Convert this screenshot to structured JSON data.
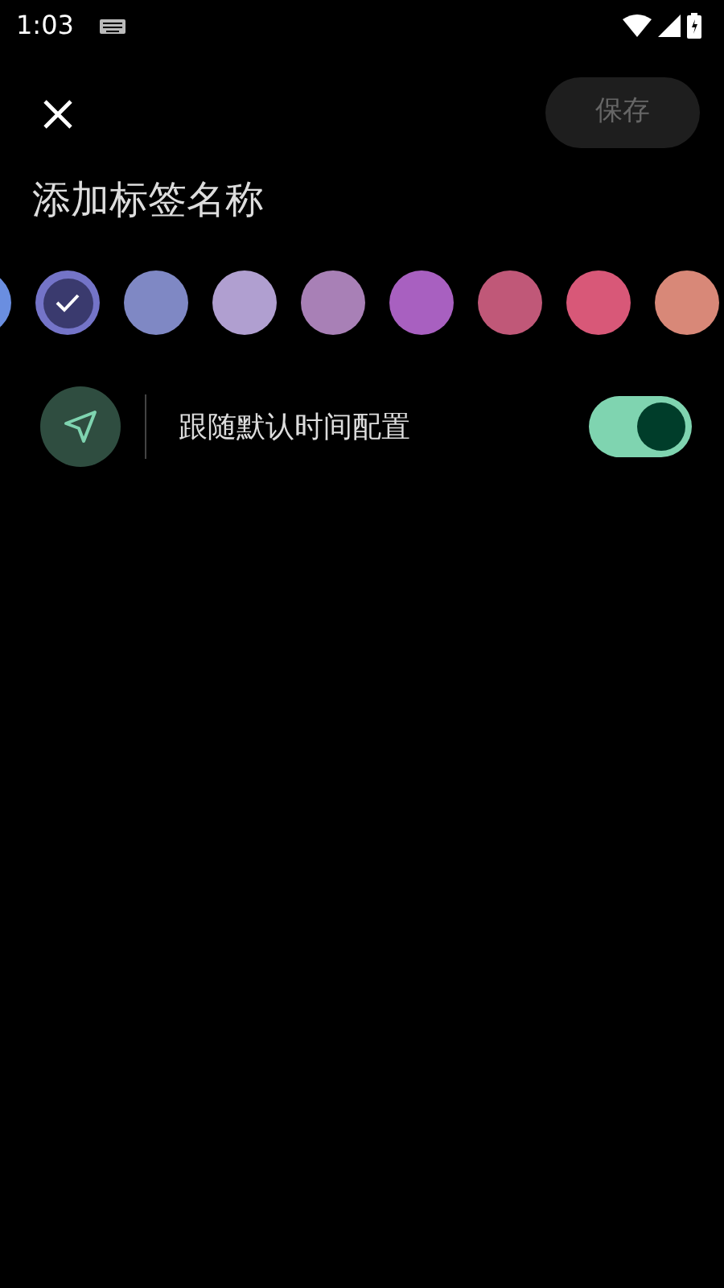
{
  "status_bar": {
    "time": "1:03"
  },
  "toolbar": {
    "save_label": "保存",
    "save_disabled": true
  },
  "name_field": {
    "placeholder": "添加标签名称"
  },
  "colors": [
    {
      "color": "#6a8ee0",
      "selected": false
    },
    {
      "color": "#7474c8",
      "selected": true
    },
    {
      "color": "#7f88c4",
      "selected": false
    },
    {
      "color": "#b09fd0",
      "selected": false
    },
    {
      "color": "#a880b6",
      "selected": false
    },
    {
      "color": "#a860c0",
      "selected": false
    },
    {
      "color": "#c05878",
      "selected": false
    },
    {
      "color": "#d85878",
      "selected": false
    },
    {
      "color": "#d88878",
      "selected": false
    }
  ],
  "follow_default": {
    "label": "跟随默认时间配置",
    "on": true
  }
}
